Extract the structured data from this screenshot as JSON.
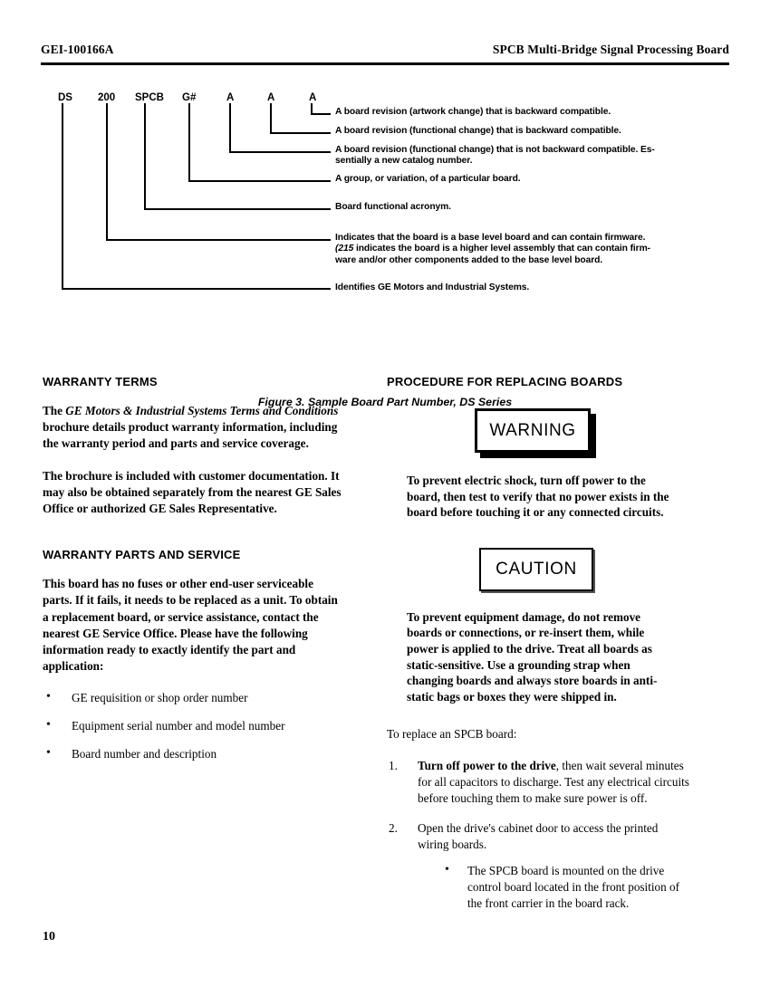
{
  "header": {
    "document_number": "GEI-100166A",
    "title": "SPCB Multi-Bridge Signal Processing Board"
  },
  "figure": {
    "caption": "Figure 3.  Sample Board Part Number, DS Series",
    "part_labels": [
      "DS",
      "200",
      "SPCB",
      "G#",
      "A",
      "A",
      "A"
    ],
    "callouts": [
      "A board revision (artwork change) that is backward compatible.",
      "A board revision (functional change) that is backward compatible.",
      "A board revision (functional change) that is not backward compatible. Essentially a new catalog number.",
      "A group, or variation, of a particular board.",
      "Board functional acronym.",
      "Indicates that the board is a base level board and can contain firmware. (215 indicates the board is a higher level assembly that can contain firmware and/or other components added to the base level board.",
      "Identifies GE Motors and Industrial Systems."
    ],
    "callout_3_line1": "A board revision (functional change) that is not backward compatible. Es-",
    "callout_3_line2": "sentially a new catalog number.",
    "callout_6_line1": "Indicates that the board is a base level board and can contain firmware.",
    "callout_6_line2_italic": "(215",
    "callout_6_line2_rest": " indicates the board is a higher level assembly that can contain firm-",
    "callout_6_line3": "ware and/or other components added to the base level board."
  },
  "left_column": {
    "warranty_terms_heading": "WARRANTY TERMS",
    "warranty_terms_p1_lead": "The ",
    "warranty_terms_p1_italic": "GE Motors & Industrial Systems Terms and Conditions",
    "warranty_terms_p1_rest": " brochure details product warranty information, including the warranty period and parts and service coverage.",
    "warranty_terms_p2": "The brochure is included with customer documentation. It may also be obtained separately from the nearest GE Sales Office or authorized GE Sales Representative.",
    "warranty_parts_heading": "WARRANTY PARTS AND SERVICE",
    "warranty_parts_p1": "This board has no fuses or other end-user serviceable parts. If it fails, it needs to be replaced as a unit. To obtain a replacement board, or service assistance, contact the nearest GE Service Office. Please have the following information ready to exactly identify the part and application:",
    "bullets": [
      "GE requisition or shop order number",
      "Equipment serial number and model number",
      "Board number and description"
    ]
  },
  "right_column": {
    "procedure_heading": "PROCEDURE FOR REPLACING BOARDS",
    "warning_label": "WARNING",
    "warning_text": "To prevent electric shock, turn off power to the board, then test to verify that no power exists in the board before touching it or any connected circuits.",
    "caution_label": "CAUTION",
    "caution_text": "To prevent equipment damage, do not remove boards or connections, or re-insert them, while power is applied to the drive. Treat all boards as static-sensitive. Use a grounding strap when changing boards and always store boards in anti-static bags or boxes they were shipped in.",
    "intro": "To replace an SPCB board:",
    "step1_bold": "Turn off power to the drive",
    "step1_rest": ", then wait several minutes for all capacitors to discharge. Test any electrical circuits before touching them to make sure power is off.",
    "step2": "Open the drive's cabinet door to access the printed wiring boards.",
    "step2_subbullet": "The SPCB board is mounted on the drive control board located in the front position of the front carrier in the board rack."
  },
  "footer": {
    "page_number": "10"
  }
}
